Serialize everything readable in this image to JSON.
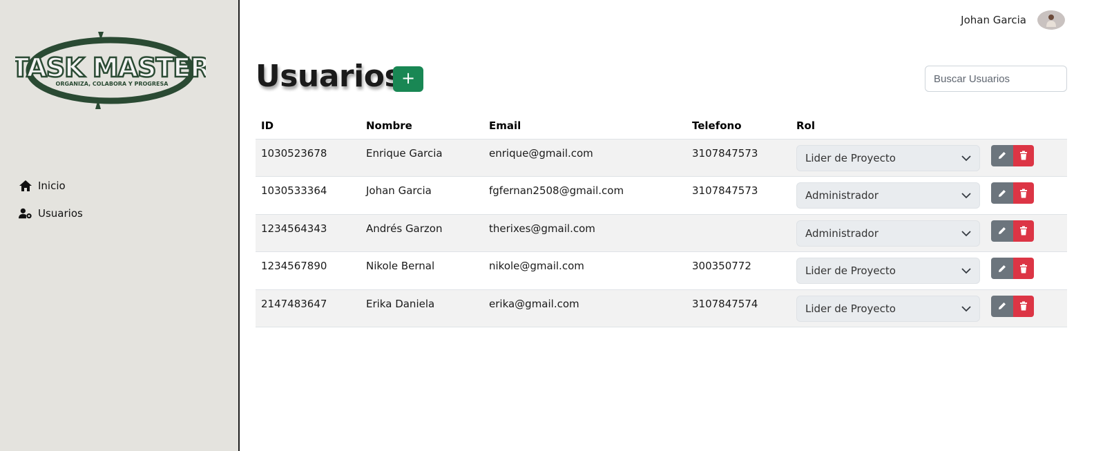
{
  "logo": {
    "title": "TASK MASTER",
    "tagline": "ORGANIZA, COLABORA Y PROGRESA"
  },
  "sidebar": {
    "items": [
      {
        "label": "Inicio",
        "icon": "home-icon"
      },
      {
        "label": "Usuarios",
        "icon": "user-cog-icon"
      }
    ]
  },
  "topbar": {
    "user_name": "Johan Garcia"
  },
  "page": {
    "title": "Usuarios",
    "add_label": "+"
  },
  "search": {
    "placeholder": "Buscar Usuarios"
  },
  "table": {
    "headers": [
      "ID",
      "Nombre",
      "Email",
      "Telefono",
      "Rol"
    ],
    "rows": [
      {
        "id": "1030523678",
        "nombre": "Enrique Garcia",
        "email": "enrique@gmail.com",
        "telefono": "3107847573",
        "rol": "Lider de Proyecto"
      },
      {
        "id": "1030533364",
        "nombre": "Johan Garcia",
        "email": "fgfernan2508@gmail.com",
        "telefono": "3107847573",
        "rol": "Administrador"
      },
      {
        "id": "1234564343",
        "nombre": "Andrés Garzon",
        "email": "therixes@gmail.com",
        "telefono": "",
        "rol": "Administrador"
      },
      {
        "id": "1234567890",
        "nombre": "Nikole Bernal",
        "email": "nikole@gmail.com",
        "telefono": "300350772",
        "rol": "Lider de Proyecto"
      },
      {
        "id": "2147483647",
        "nombre": "Erika Daniela",
        "email": "erika@gmail.com",
        "telefono": "3107847574",
        "rol": "Lider de Proyecto"
      }
    ]
  },
  "colors": {
    "brand": "#2a4a33",
    "add": "#198754",
    "edit": "#6c757d",
    "delete": "#dc3545",
    "sidebar_bg": "#e4e3de"
  }
}
